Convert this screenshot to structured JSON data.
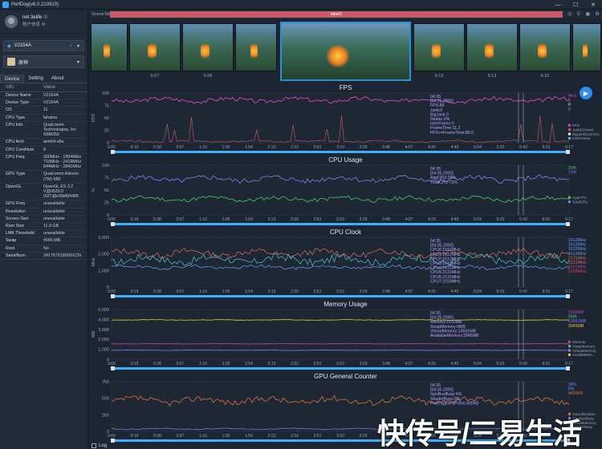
{
  "window": {
    "title": "PerfDog(v6.0.210910)",
    "controls": [
      "—",
      "☐",
      "✕"
    ]
  },
  "profile": {
    "username": "net 3elife",
    "plan": "账户信息",
    "gender_icon": "☉",
    "gear": "⚙"
  },
  "device_select": {
    "value": "V2154A",
    "icon": "◆"
  },
  "app_select": {
    "value": "原神"
  },
  "tabs": [
    "Device",
    "Setting",
    "About"
  ],
  "info_headers": {
    "key": "Info",
    "value": "Value"
  },
  "info_rows": [
    {
      "k": "Device Name",
      "v": "V2154A"
    },
    {
      "k": "Device Type",
      "v": "V2154A"
    },
    {
      "k": "OS",
      "v": "11"
    },
    {
      "k": "CPU Type",
      "v": "lahaina"
    },
    {
      "k": "CPU Info",
      "v": "Qualcomm Technologies, Inc SM8350"
    },
    {
      "k": "CPU Arch",
      "v": "arm64-v8a"
    },
    {
      "k": "CPU CoreNum",
      "v": "8"
    },
    {
      "k": "CPU Freq",
      "v": "300MHz - 1804MHz 710MHz - 2419MHz 844MHz - 2841MHz"
    },
    {
      "k": "GPU Type",
      "v": "Qualcomm Adreno (TM) 660"
    },
    {
      "k": "OpenGL",
      "v": "OpenGL ES 3.2 V@0530.0 (GIT@e39df94495"
    },
    {
      "k": "GPU Freq",
      "v": "unavailable"
    },
    {
      "k": "Resolution",
      "v": "unavailable"
    },
    {
      "k": "Screen Size",
      "v": "unavailable"
    },
    {
      "k": "Ram Size",
      "v": "11.0 GB"
    },
    {
      "k": "LMK Threshold",
      "v": "unavailable"
    },
    {
      "k": "Swap",
      "v": "4096 MB"
    },
    {
      "k": "Root",
      "v": "No"
    },
    {
      "k": "SerialNum",
      "v": "341767919D001CN"
    }
  ],
  "scene": {
    "tab": "SceneTab",
    "label": "label1"
  },
  "thumb_times": [
    "6:07",
    "6:08",
    "",
    "6:13",
    "6:13",
    "6:15"
  ],
  "time_ticks": [
    "0:00",
    "0:19",
    "0:38",
    "0:57",
    "1:16",
    "1:35",
    "1:54",
    "2:13",
    "2:32",
    "2:51",
    "3:10",
    "3:29",
    "3:48",
    "4:07",
    "4:26",
    "4:45",
    "5:04",
    "5:23",
    "5:42",
    "6:01",
    "6:17"
  ],
  "charts": [
    {
      "title": "FPS",
      "ylabel": "FPS",
      "yticks": [
        "0",
        "25",
        "50",
        "75",
        "100"
      ],
      "tooltip": [
        "04:35",
        "[04:35.2000]",
        "FPS:89",
        "Jank:0",
        "BigJank:0",
        "Stutter:0%",
        "InterFrame:0",
        "FrameTime:11.2",
        "FPS>=FrameTime:85.0"
      ],
      "legend": [
        {
          "name": "FPS",
          "color": "#e040c8"
        },
        {
          "name": "Jank(/10min)",
          "color": "#c85a6a"
        },
        {
          "name": "BigJank(/10min)",
          "color": "#e8e8e8"
        },
        {
          "name": "InterFrame",
          "color": "#6da0ff"
        }
      ],
      "right_values": [
        {
          "t": "44.6",
          "c": "#e040c8"
        },
        {
          "t": "0",
          "c": "#c85a6a"
        },
        {
          "t": "0",
          "c": "#e8e8e8"
        },
        {
          "t": "0",
          "c": "#6da0ff"
        }
      ]
    },
    {
      "title": "CPU Usage",
      "ylabel": "%",
      "yticks": [
        "0",
        "25",
        "50",
        "75",
        "100"
      ],
      "tooltip": [
        "04:35",
        "[04:35.2000]",
        "AppCPU:29%",
        "TotalCPU:73%"
      ],
      "legend": [
        {
          "name": "AppCPU",
          "color": "#4cc870"
        },
        {
          "name": "TotalCPU",
          "color": "#8a7cf0"
        }
      ],
      "right_values": [
        {
          "t": "29%",
          "c": "#4cc870"
        },
        {
          "t": "73%",
          "c": "#8a7cf0"
        }
      ]
    },
    {
      "title": "CPU Clock",
      "ylabel": "MHz",
      "yticks": [
        "0",
        "1,000",
        "2,000",
        "3,000"
      ],
      "tooltip": [
        "04:35",
        "[04:35.2000]",
        "CPU0:1612MHz",
        "CPU1:1612MHz",
        "CPU2:1612MHz",
        "CPU3:1612MHz",
        "CPU4:2131MHz",
        "CPU5:2131MHz",
        "CPU6:2131MHz",
        "CPU7:2150MHz"
      ],
      "legend": [],
      "right_values": [
        {
          "t": "1612MHz",
          "c": "#6da0ff"
        },
        {
          "t": "1612MHz",
          "c": "#6da0ff"
        },
        {
          "t": "1612MHz",
          "c": "#6da0ff"
        },
        {
          "t": "1612MHz",
          "c": "#6da0ff"
        },
        {
          "t": "2131MHz",
          "c": "#e0705a"
        },
        {
          "t": "2131MHz",
          "c": "#e0705a"
        },
        {
          "t": "2131MHz",
          "c": "#c040b0"
        },
        {
          "t": "2150MHz",
          "c": "#e04060"
        }
      ]
    },
    {
      "title": "Memory Usage",
      "ylabel": "MB",
      "yticks": [
        "0",
        "1,000",
        "2,000",
        "3,000",
        "4,000",
        "5,000"
      ],
      "tooltip": [
        "04:35",
        "[04:35.2000]",
        "Memory:1550MB",
        "SwapMemory:0MB",
        "VirtualMemory:13561MB",
        "AvailableMemory:3945MB"
      ],
      "legend": [
        {
          "name": "Memory",
          "color": "#c040b0"
        },
        {
          "name": "SwapMemory",
          "color": "#4cc870"
        },
        {
          "name": "VirtualMemory",
          "color": "#8a7cf0"
        },
        {
          "name": "AvailableMe...",
          "color": "#e8c040"
        }
      ],
      "right_values": [
        {
          "t": "1550MB",
          "c": "#c040b0"
        },
        {
          "t": "0MB",
          "c": "#4cc870"
        },
        {
          "t": "13561MB",
          "c": "#8a7cf0"
        },
        {
          "t": "3945MB",
          "c": "#e8c040"
        }
      ]
    },
    {
      "title": "GPU General Counter",
      "ylabel": "",
      "yticks": [
        "0",
        "250",
        "500",
        "750"
      ],
      "tooltip": [
        "04:35",
        "[04:35.2000]",
        "GpuBusBusy:4%",
        "ShaderBusy:0%",
        "PreFragmentPrims:400KB"
      ],
      "legend": [
        {
          "name": "GpuUtilization",
          "color": "#e0703a"
        },
        {
          "name": "GpuBusBusy",
          "color": "#8a7cf0"
        },
        {
          "name": "VirtualMemory",
          "color": "#6da0ff"
        },
        {
          "name": "ShaderBusy",
          "color": "#c040b0"
        }
      ],
      "right_values": [
        {
          "t": "38%",
          "c": "#8a7cf0"
        },
        {
          "t": "0%",
          "c": "#6da0ff"
        },
        {
          "t": "4660KB",
          "c": "#e0703a"
        }
      ]
    }
  ],
  "bottom": {
    "log_label": "Log"
  },
  "watermark": "快传号/三易生活"
}
